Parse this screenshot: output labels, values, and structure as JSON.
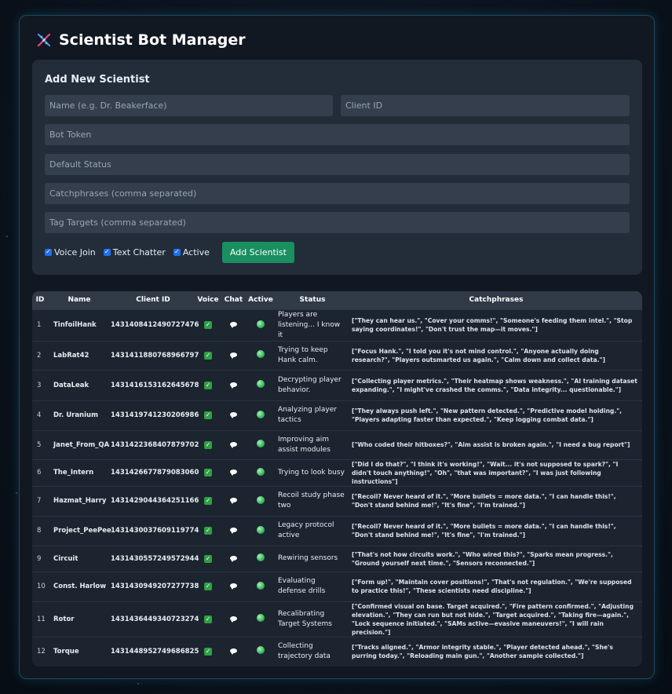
{
  "app": {
    "title": "Scientist Bot Manager",
    "logo_icon": "dna-icon"
  },
  "form": {
    "title": "Add New Scientist",
    "name_placeholder": "Name (e.g. Dr. Beakerface)",
    "client_id_placeholder": "Client ID",
    "token_placeholder": "Bot Token",
    "status_placeholder": "Default Status",
    "catchphrases_placeholder": "Catchphrases (comma separated)",
    "tags_placeholder": "Tag Targets (comma separated)",
    "voice_label": "Voice Join",
    "chatter_label": "Text Chatter",
    "active_label": "Active",
    "voice_checked": true,
    "chatter_checked": true,
    "active_checked": true,
    "submit_label": "Add Scientist"
  },
  "table": {
    "columns": {
      "id": "ID",
      "name": "Name",
      "client_id": "Client ID",
      "voice": "Voice",
      "chat": "Chat",
      "active": "Active",
      "status": "Status",
      "catchphrases": "Catchphrases"
    },
    "rows": [
      {
        "id": "1",
        "name": "TinfoilHank",
        "client_id": "1431408412490727476",
        "status": "Players are listening... I know it",
        "catchphrases": "[\"They can hear us.\", \"Cover your comms!\", \"Someone's feeding them intel.\", \"Stop saying coordinates!\", \"Don't trust the map—it moves.\"]"
      },
      {
        "id": "2",
        "name": "LabRat42",
        "client_id": "1431411880768966797",
        "status": "Trying to keep Hank calm.",
        "catchphrases": "[\"Focus Hank.\", \"I told you it's not mind control.\", \"Anyone actually doing research?\", \"Players outsmarted us again.\", \"Calm down and collect data.\"]"
      },
      {
        "id": "3",
        "name": "DataLeak",
        "client_id": "1431416153162645678",
        "status": "Decrypting player behavior.",
        "catchphrases": "[\"Collecting player metrics.\", \"Their heatmap shows weakness.\", \"AI training dataset expanding.\", \"I might've crashed the comms.\", \"Data integrity... questionable.\"]"
      },
      {
        "id": "4",
        "name": "Dr. Uranium",
        "client_id": "1431419741230206986",
        "status": "Analyzing player tactics",
        "catchphrases": "[\"They always push left.\", \"New pattern detected.\", \"Predictive model holding.\", \"Players adapting faster than expected.\", \"Keep logging combat data.\"]"
      },
      {
        "id": "5",
        "name": "Janet_From_QA",
        "client_id": "1431422368407879702",
        "status": "Improving aim assist modules",
        "catchphrases": "[\"Who coded their hitboxes?\", \"Aim assist is broken again.\", \"I need a bug report\"]"
      },
      {
        "id": "6",
        "name": "The_Intern",
        "client_id": "1431426677879083060",
        "status": "Trying to look busy",
        "catchphrases": "[\"Did I do that?\", \"I think it's working!\", \"Wait... it's not supposed to spark?\", \"I didn't touch anything!\", \"Oh\", \"that was important?\", \"I was just following instructions\"]"
      },
      {
        "id": "7",
        "name": "Hazmat_Harry",
        "client_id": "1431429044364251166",
        "status": "Recoil study phase two",
        "catchphrases": "[\"Recoil? Never heard of it.\", \"More bullets = more data.\", \"I can handle this!\", \"Don't stand behind me!\", \"It's fine\", \"I'm trained.\"]"
      },
      {
        "id": "8",
        "name": "Project_PeePee",
        "client_id": "1431430037609119774",
        "status": "Legacy protocol active",
        "catchphrases": "[\"Recoil? Never heard of it.\", \"More bullets = more data.\", \"I can handle this!\", \"Don't stand behind me!\", \"It's fine\", \"I'm trained.\"]"
      },
      {
        "id": "9",
        "name": "Circuit",
        "client_id": "1431430557249572944",
        "status": "Rewiring sensors",
        "catchphrases": "[\"That's not how circuits work.\", \"Who wired this?\", \"Sparks mean progress.\", \"Ground yourself next time.\", \"Sensors reconnected.\"]"
      },
      {
        "id": "10",
        "name": "Const. Harlow",
        "client_id": "1431430949207277738",
        "status": "Evaluating defense drills",
        "catchphrases": "[\"Form up!\", \"Maintain cover positions!\", \"That's not regulation.\", \"We're supposed to practice this!\", \"These scientists need discipline.\"]"
      },
      {
        "id": "11",
        "name": "Rotor",
        "client_id": "1431436449340723274",
        "status": "Recalibrating Target Systems",
        "catchphrases": "[\"Confirmed visual on base. Target acquired.\", \"Fire pattern confirmed.\", \"Adjusting elevation.\", \"They can run but not hide.\", \"Target acquired.\", \"Taking fire—again.\", \"Lock sequence initiated.\", \"SAMs active—evasive maneuvers!\", \"I will rain precision.\"]"
      },
      {
        "id": "12",
        "name": "Torque",
        "client_id": "1431448952749686825",
        "status": "Collecting trajectory data",
        "catchphrases": "[\"Tracks aligned.\", \"Armor integrity stable.\", \"Player detected ahead.\", \"She's purring today.\", \"Reloading main gun.\", \"Another sample collected.\"]"
      }
    ],
    "voice_icon": "checkmark-icon",
    "chat_icon": "speech-bubble-icon",
    "active_icon": "green-dot-icon"
  },
  "colors": {
    "accent": "#1a8f5f",
    "background": "#0a121c",
    "card": "#232c39",
    "checkbox": "#1f6feb",
    "active": "#3fbf5f"
  }
}
